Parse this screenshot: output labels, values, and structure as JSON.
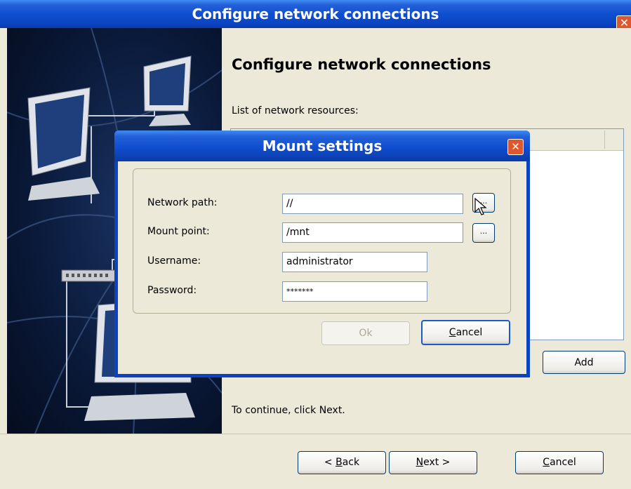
{
  "window": {
    "title": "Configure network connections",
    "close_symbol": "✕"
  },
  "main": {
    "heading": "Configure network connections",
    "list_label": "List of network resources:",
    "add_label": "Add",
    "continue_text": "To continue, click Next."
  },
  "nav": {
    "back_prefix": "< ",
    "back_key": "B",
    "back_rest": "ack",
    "next_key": "N",
    "next_rest": "ext >",
    "cancel_key": "C",
    "cancel_rest": "ancel"
  },
  "dialog": {
    "title": "Mount settings",
    "close_symbol": "✕",
    "network_path_label": "Network path:",
    "network_path_value": "//",
    "mount_point_label": "Mount point:",
    "mount_point_value": "/mnt",
    "username_label": "Username:",
    "username_value": "administrator",
    "password_label": "Password:",
    "password_value": "*******",
    "browse_label": "...",
    "ok_label": "Ok",
    "cancel_key": "C",
    "cancel_rest": "ancel"
  }
}
